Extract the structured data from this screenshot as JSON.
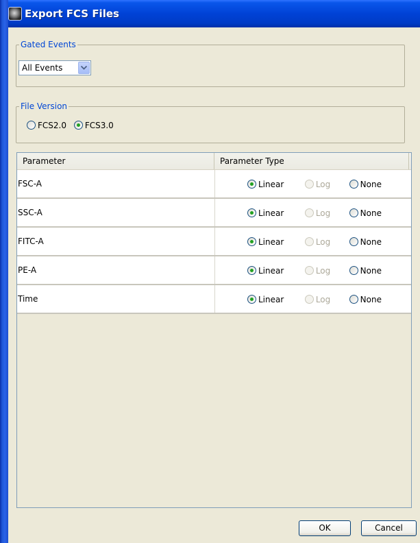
{
  "window": {
    "title": "Export FCS Files",
    "icon": "app-icon"
  },
  "gated_events": {
    "legend": "Gated Events",
    "selected": "All Events",
    "icon": "chevron-down-icon"
  },
  "file_version": {
    "legend": "File Version",
    "options": [
      {
        "label": "FCS2.0",
        "checked": false
      },
      {
        "label": "FCS3.0",
        "checked": true
      }
    ]
  },
  "table": {
    "headers": [
      "Parameter",
      "Parameter Type"
    ],
    "type_labels": {
      "linear": "Linear",
      "log": "Log",
      "none": "None"
    },
    "rows": [
      {
        "name": "FSC-A",
        "selected": "Linear"
      },
      {
        "name": "SSC-A",
        "selected": "Linear"
      },
      {
        "name": "FITC-A",
        "selected": "Linear"
      },
      {
        "name": "PE-A",
        "selected": "Linear"
      },
      {
        "name": "Time",
        "selected": "Linear"
      }
    ]
  },
  "buttons": {
    "ok": "OK",
    "cancel": "Cancel"
  },
  "colors": {
    "title_bar": "#0042d6",
    "legend_text": "#0046d5",
    "window_bg": "#ece9d8",
    "radio_checked": "#21a121"
  }
}
